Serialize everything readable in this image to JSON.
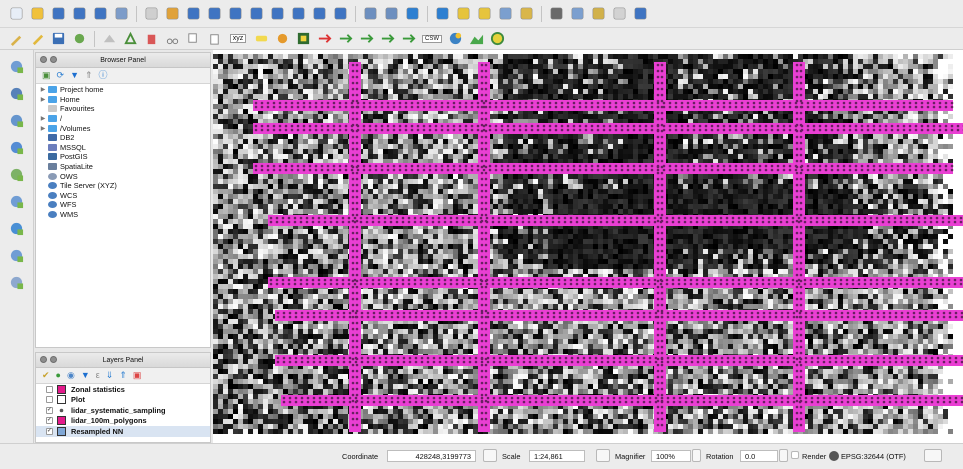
{
  "toolbar1": {
    "icons": [
      "new-project",
      "open-project",
      "save-project",
      "save-as",
      "new-print-layout",
      "layout-manager",
      "pan-map",
      "pan-to-selection",
      "zoom-in",
      "zoom-out",
      "zoom-full",
      "zoom-to-selection",
      "zoom-to-layer",
      "zoom-native",
      "zoom-last",
      "zoom-next",
      "new-bookmark",
      "show-bookmarks",
      "refresh",
      "identify",
      "select-features",
      "deselect",
      "open-attribute-table",
      "field-calculator",
      "statistical-summary",
      "measure",
      "annotation",
      "text-annotation",
      "map-tips"
    ]
  },
  "toolbar2": {
    "csw_label": "CSW",
    "key_label": "xyz"
  },
  "left_tools": {
    "icons": [
      "add-vector",
      "add-raster",
      "add-mesh",
      "add-delimited-text",
      "add-spatialite",
      "add-geopackage",
      "add-wms",
      "add-wcs",
      "add-virtual-layer"
    ]
  },
  "browser_panel": {
    "title": "Browser Panel",
    "items": [
      {
        "label": "Project home",
        "icon": "folder",
        "expandable": true
      },
      {
        "label": "Home",
        "icon": "folder",
        "expandable": true
      },
      {
        "label": "Favourites",
        "icon": "star",
        "expandable": false
      },
      {
        "label": "/",
        "icon": "folder",
        "expandable": true
      },
      {
        "label": "/Volumes",
        "icon": "folder",
        "expandable": true
      },
      {
        "label": "DB2",
        "icon": "db2",
        "expandable": false
      },
      {
        "label": "MSSQL",
        "icon": "mssql",
        "expandable": false
      },
      {
        "label": "PostGIS",
        "icon": "postgis",
        "expandable": false
      },
      {
        "label": "SpatiaLite",
        "icon": "spatialite",
        "expandable": false
      },
      {
        "label": "OWS",
        "icon": "ows",
        "expandable": false
      },
      {
        "label": "Tile Server (XYZ)",
        "icon": "globe",
        "expandable": false
      },
      {
        "label": "WCS",
        "icon": "globe",
        "expandable": false
      },
      {
        "label": "WFS",
        "icon": "globe",
        "expandable": false
      },
      {
        "label": "WMS",
        "icon": "globe",
        "expandable": false
      }
    ]
  },
  "layers_panel": {
    "title": "Layers Panel",
    "layers": [
      {
        "name": "Zonal statistics",
        "checked": false,
        "swatch": "#e31a8b",
        "symbol": "fill"
      },
      {
        "name": "Plot",
        "checked": false,
        "swatch": "#ffffff",
        "symbol": "fill"
      },
      {
        "name": "lidar_systematic_sampling",
        "checked": true,
        "swatch": "#555555",
        "symbol": "point"
      },
      {
        "name": "lidar_100m_polygons",
        "checked": true,
        "swatch": "#e31a8b",
        "symbol": "fill"
      },
      {
        "name": "Resampled NN",
        "checked": true,
        "swatch": "#7fa7d6",
        "symbol": "raster"
      }
    ]
  },
  "status_bar": {
    "coordinate_label": "Coordinate",
    "coordinate_value": "428248,3199773",
    "scale_label": "Scale",
    "scale_value": "1:24,861",
    "magnifier_label": "Magnifier",
    "magnifier_value": "100%",
    "rotation_label": "Rotation",
    "rotation_value": "0.0",
    "render_label": "Render",
    "crs_label": "EPSG:32644 (OTF)"
  },
  "colors": {
    "grid_magenta": "#e93fd3",
    "grid_dot": "#6a1f62",
    "zonal_swatch": "#e31a8b"
  }
}
